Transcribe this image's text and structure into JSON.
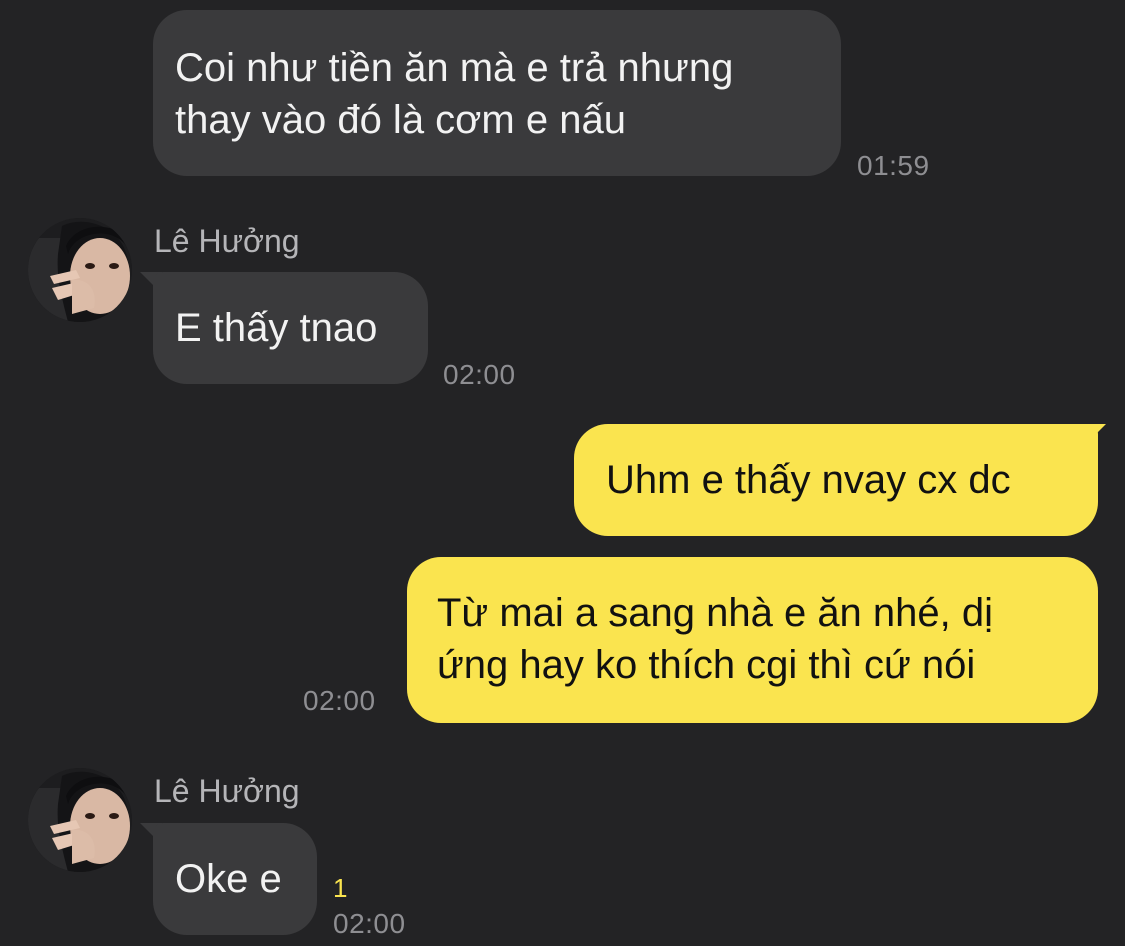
{
  "messages": [
    {
      "direction": "incoming",
      "lines": [
        "Coi như tiền ăn mà e trả nhưng",
        "thay vào đó là cơm e nấu"
      ],
      "time": "01:59"
    },
    {
      "direction": "incoming",
      "sender": "Lê Hưởng",
      "lines": [
        "E thấy tnao"
      ],
      "time": "02:00"
    },
    {
      "direction": "outgoing",
      "lines": [
        "Uhm e thấy nvay cx dc"
      ]
    },
    {
      "direction": "outgoing",
      "lines": [
        "Từ mai a sang nhà e ăn nhé, dị",
        "ứng hay ko thích cgi thì cứ nói"
      ],
      "time": "02:00"
    },
    {
      "direction": "incoming",
      "sender": "Lê Hưởng",
      "lines": [
        "Oke e"
      ],
      "time": "02:00",
      "unread_count": "1"
    }
  ],
  "colors": {
    "background": "#232325",
    "incoming_bubble": "#3a3a3c",
    "outgoing_bubble": "#fae44f",
    "timestamp": "#8e8e92",
    "unread_badge": "#fae44f"
  },
  "icons": {
    "avatar": "contact-avatar-photo"
  }
}
